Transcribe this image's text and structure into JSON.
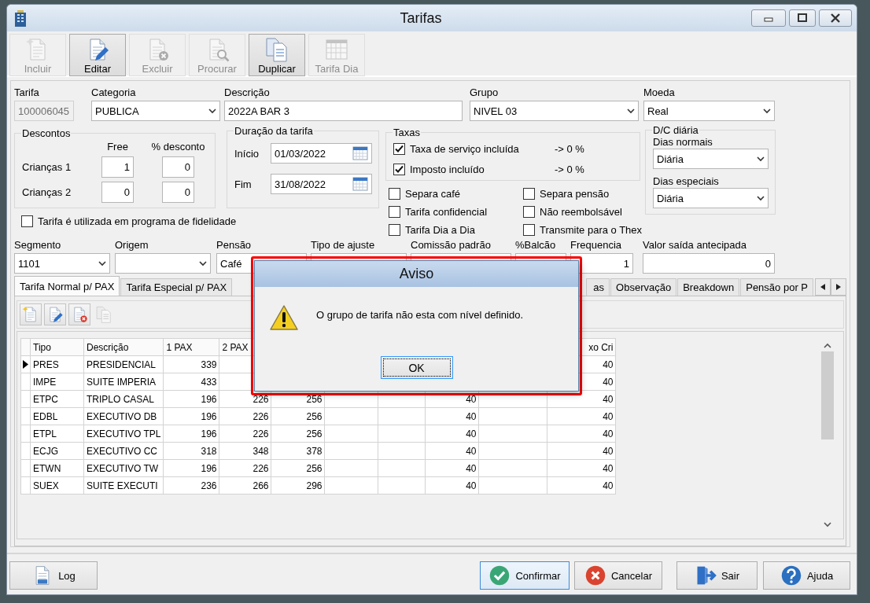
{
  "window": {
    "title": "Tarifas"
  },
  "toolbar": [
    {
      "label": "Incluir",
      "kind": "new",
      "disabled": true
    },
    {
      "label": "Editar",
      "kind": "edit",
      "disabled": false
    },
    {
      "label": "Excluir",
      "kind": "delete",
      "disabled": true
    },
    {
      "label": "Procurar",
      "kind": "search",
      "disabled": true
    },
    {
      "label": "Duplicar",
      "kind": "copy",
      "disabled": false
    },
    {
      "label": "Tarifa Dia",
      "kind": "table",
      "disabled": true
    }
  ],
  "header_fields": [
    {
      "label": "Tarifa",
      "value": "100006045",
      "kind": "text",
      "disabled": true
    },
    {
      "label": "Categoria",
      "value": "PUBLICA",
      "kind": "select",
      "disabled": false
    },
    {
      "label": "Descrição",
      "value": "2022A BAR 3",
      "kind": "text",
      "disabled": false
    },
    {
      "label": "Grupo",
      "value": "NIVEL 03",
      "kind": "select",
      "disabled": false
    },
    {
      "label": "Moeda",
      "value": "Real",
      "kind": "select",
      "disabled": false
    }
  ],
  "descontos": {
    "title": "Descontos",
    "columns": [
      "Free",
      "% desconto"
    ],
    "rows": [
      {
        "label": "Crianças 1",
        "values": [
          "1",
          "0"
        ]
      },
      {
        "label": "Crianças 2",
        "values": [
          "0",
          "0"
        ]
      }
    ]
  },
  "fidelidade": {
    "label": "Tarifa é utilizada em programa de fidelidade",
    "checked": false
  },
  "duracao": {
    "title": "Duração da tarifa",
    "dates": [
      {
        "label": "Início",
        "value": "01/03/2022"
      },
      {
        "label": "Fim",
        "value": "31/08/2022"
      }
    ]
  },
  "taxas": {
    "title": "Taxas",
    "items": [
      {
        "label": "Taxa de serviço incluída",
        "checked": true,
        "rate": "-> 0 %"
      },
      {
        "label": "Imposto incluído",
        "checked": true,
        "rate": "-> 0 %"
      }
    ]
  },
  "options": [
    {
      "label": "Separa café",
      "checked": false
    },
    {
      "label": "Separa pensão",
      "checked": false
    },
    {
      "label": "Tarifa confidencial",
      "checked": false
    },
    {
      "label": "Não reembolsável",
      "checked": false
    },
    {
      "label": "Tarifa Dia a Dia",
      "checked": false
    },
    {
      "label": "Transmite para o Thex",
      "checked": false
    }
  ],
  "dc_diaria": {
    "title": "D/C diária",
    "selects": [
      {
        "label": "Dias normais",
        "value": "Diária"
      },
      {
        "label": "Dias especiais",
        "value": "Diária"
      }
    ]
  },
  "detail_fields": [
    {
      "label": "Segmento",
      "value": "1101",
      "kind": "select"
    },
    {
      "label": "Origem",
      "kind": "select"
    },
    {
      "label": "Pensão",
      "value": "Café",
      "kind": "entry"
    },
    {
      "label": "Tipo de ajuste",
      "kind": "text"
    },
    {
      "label": "Comissão padrão",
      "kind": "text"
    },
    {
      "label": "%Balcão",
      "kind": "text"
    },
    {
      "label": "Frequencia",
      "value": "1",
      "kind": "text"
    },
    {
      "label": "Valor saída antecipada",
      "value": "0",
      "kind": "text"
    }
  ],
  "tabs": [
    {
      "label": "Tarifa Normal p/ PAX",
      "selected": true
    },
    {
      "label": "Tarifa Especial p/ PAX",
      "selected": false
    },
    {
      "label": "as",
      "selected": false
    },
    {
      "label": "Observação",
      "selected": false
    },
    {
      "label": "Breakdown",
      "selected": false
    },
    {
      "label": "Pensão por P",
      "selected": false
    }
  ],
  "grid_toolbar": [
    {
      "kind": "new",
      "disabled": false
    },
    {
      "kind": "edit",
      "disabled": false
    },
    {
      "kind": "delete",
      "disabled": false
    },
    {
      "kind": "copy",
      "disabled": true
    }
  ],
  "grid": {
    "columns": [
      "Tipo",
      "Descrição",
      "1 PAX",
      "2 PAX",
      null,
      null,
      null,
      null,
      null,
      "xo Cri"
    ],
    "rows": [
      {
        "selected": true,
        "cells": [
          "PRES",
          "PRESIDENCIAL",
          "339",
          null,
          null,
          null,
          null,
          null,
          null,
          "40"
        ]
      },
      {
        "selected": false,
        "cells": [
          "IMPE",
          "SUITE IMPERIA",
          "433",
          null,
          null,
          null,
          null,
          null,
          null,
          "40"
        ]
      },
      {
        "selected": false,
        "cells": [
          "ETPC",
          "TRIPLO CASAL",
          "196",
          "226",
          "256",
          null,
          null,
          "40",
          null,
          "40"
        ]
      },
      {
        "selected": false,
        "cells": [
          "EDBL",
          "EXECUTIVO DB",
          "196",
          "226",
          "256",
          null,
          null,
          "40",
          null,
          "40"
        ]
      },
      {
        "selected": false,
        "cells": [
          "ETPL",
          "EXECUTIVO TPL",
          "196",
          "226",
          "256",
          null,
          null,
          "40",
          null,
          "40"
        ]
      },
      {
        "selected": false,
        "cells": [
          "ECJG",
          "EXECUTIVO CC",
          "318",
          "348",
          "378",
          null,
          null,
          "40",
          null,
          "40"
        ]
      },
      {
        "selected": false,
        "cells": [
          "ETWN",
          "EXECUTIVO TW",
          "196",
          "226",
          "256",
          null,
          null,
          "40",
          null,
          "40"
        ]
      },
      {
        "selected": false,
        "cells": [
          "SUEX",
          "SUITE EXECUTI",
          "236",
          "266",
          "296",
          null,
          null,
          "40",
          null,
          "40"
        ]
      }
    ]
  },
  "dialog": {
    "title": "Aviso",
    "message": "O grupo de tarifa não esta com nível definido.",
    "button": {
      "label": "OK",
      "focused": true
    }
  },
  "bottom_buttons": [
    {
      "label": "Log",
      "kind": "log",
      "focused": false
    },
    {
      "label": "Confirmar",
      "kind": "confirm",
      "focused": true
    },
    {
      "label": "Cancelar",
      "kind": "cancel",
      "focused": false
    },
    {
      "label": "Sair",
      "kind": "exit",
      "focused": false
    },
    {
      "label": "Ajuda",
      "kind": "help",
      "focused": false
    }
  ]
}
